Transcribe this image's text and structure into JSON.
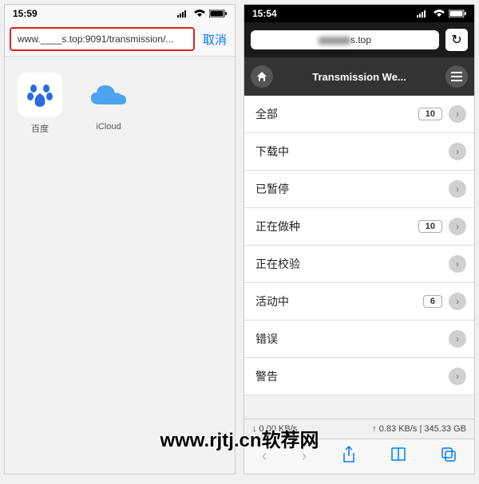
{
  "left": {
    "time": "15:59",
    "url": "www.____s.top:9091/transmission/...",
    "cancel": "取消",
    "icons": {
      "baidu": "百度",
      "icloud": "iCloud"
    }
  },
  "right": {
    "time": "15:54",
    "url": "____s.top",
    "title": "Transmission We...",
    "rows": [
      {
        "label": "全部",
        "badge": "10"
      },
      {
        "label": "下载中",
        "badge": null
      },
      {
        "label": "已暂停",
        "badge": null
      },
      {
        "label": "正在做种",
        "badge": "10"
      },
      {
        "label": "正在校验",
        "badge": null
      },
      {
        "label": "活动中",
        "badge": "6"
      },
      {
        "label": "错误",
        "badge": null
      },
      {
        "label": "警告",
        "badge": null
      }
    ],
    "stats_down": "↓ 0.00 KB/s",
    "stats_up": "↑ 0.83 KB/s | 345.33 GB"
  },
  "watermark": "www.rjtj.cn软荐网"
}
